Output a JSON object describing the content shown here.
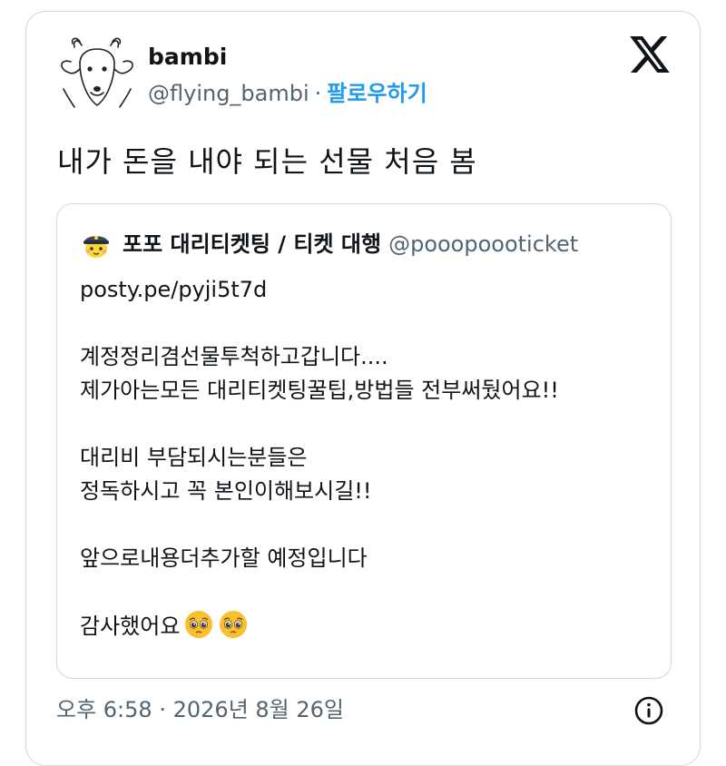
{
  "tweet": {
    "author_name": "bambi",
    "author_handle": "@flying_bambi",
    "separator": "·",
    "follow_label": "팔로우하기",
    "text": "내가 돈을 내야 되는 선물 처음 봄",
    "icons": {
      "avatar": "deer-sketch-avatar",
      "platform": "x-logo-icon",
      "info": "info-icon"
    }
  },
  "quoted_tweet": {
    "author_name": "포포 대리티켓팅 / 티켓 대행",
    "author_handle": "@pooopoooticket",
    "link": "posty.pe/pyji5t7d",
    "lines": [
      "",
      "계정정리겸선물투척하고갑니다....",
      "제가아는모든 대리티켓팅꿀팁,방법들 전부써뒀어요!!",
      "",
      "대리비 부담되시는분들은",
      "정독하시고 꼭 본인이해보시길!!",
      "",
      "앞으로내용더추가할 예정입니다",
      ""
    ],
    "closing_text": "감사했어요",
    "closing_emojis": [
      "pleading-face-emoji",
      "pleading-face-emoji"
    ]
  },
  "meta": {
    "time": "오후 6:58",
    "separator": "·",
    "date": "2026년 8월 26일"
  },
  "colors": {
    "accent": "#1d9bf0",
    "secondary_text": "#536471",
    "border": "#cfd9de",
    "emoji_yellow": "#fbc02d"
  }
}
